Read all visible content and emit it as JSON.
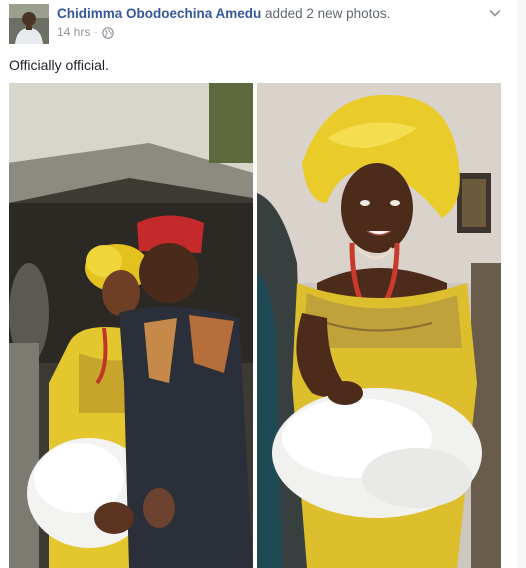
{
  "post": {
    "author_name": "Chidimma Obodoechina Amedu",
    "action_text": "added 2 new photos.",
    "timestamp": "14 hrs",
    "separator": "·",
    "privacy_icon": "globe-icon",
    "menu_icon": "chevron-down-icon",
    "caption": "Officially official."
  },
  "photos": [
    {
      "name": "photo-couple",
      "description_icon": "photo"
    },
    {
      "name": "photo-bride",
      "description_icon": "photo"
    }
  ],
  "colors": {
    "link": "#365899",
    "secondary_text": "#90949c",
    "body_text": "#1d2129"
  }
}
